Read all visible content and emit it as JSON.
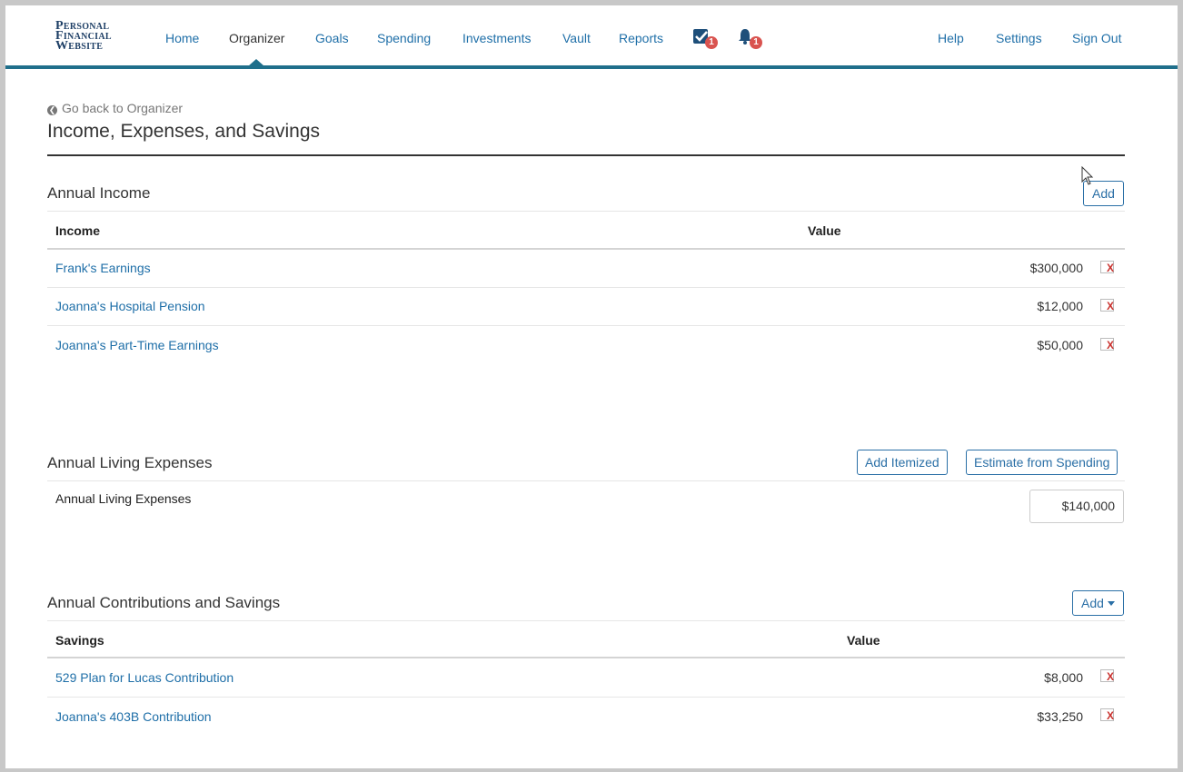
{
  "logo": {
    "line1": "Personal",
    "line2": "Financial",
    "line3": "Website"
  },
  "nav": {
    "home": "Home",
    "organizer": "Organizer",
    "goals": "Goals",
    "spending": "Spending",
    "investments": "Investments",
    "vault": "Vault",
    "reports": "Reports",
    "tasks_badge": "1",
    "alerts_badge": "1",
    "help": "Help",
    "settings": "Settings",
    "sign_out": "Sign Out"
  },
  "back_link": "Go back to Organizer",
  "page_title": "Income, Expenses, and Savings",
  "income": {
    "title": "Annual Income",
    "add_label": "Add",
    "col_name": "Income",
    "col_value": "Value",
    "rows": [
      {
        "name": "Frank's Earnings",
        "value": "$300,000"
      },
      {
        "name": "Joanna's Hospital Pension",
        "value": "$12,000"
      },
      {
        "name": "Joanna's Part-Time Earnings",
        "value": "$50,000"
      }
    ]
  },
  "expenses": {
    "title": "Annual Living Expenses",
    "add_itemized_label": "Add Itemized",
    "estimate_label": "Estimate from Spending",
    "field_label": "Annual Living Expenses",
    "field_value": "$140,000"
  },
  "savings": {
    "title": "Annual Contributions and Savings",
    "add_label": "Add",
    "col_name": "Savings",
    "col_value": "Value",
    "rows": [
      {
        "name": "529 Plan for Lucas Contribution",
        "value": "$8,000"
      },
      {
        "name": "Joanna's 403B Contribution",
        "value": "$33,250"
      }
    ]
  },
  "delete_glyph": "X",
  "colors": {
    "accent": "#1f6f8b",
    "link": "#1f6fa8",
    "danger": "#c9302c",
    "logo": "#1e3f66"
  }
}
